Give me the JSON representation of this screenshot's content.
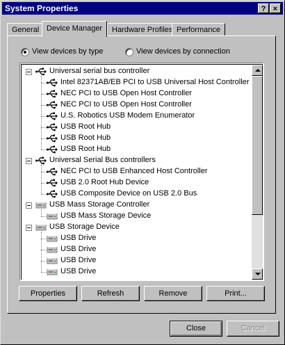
{
  "window": {
    "title": "System Properties",
    "help_label": "?",
    "close_label": "×"
  },
  "tabs": [
    {
      "label": "General",
      "active": false
    },
    {
      "label": "Device Manager",
      "active": true
    },
    {
      "label": "Hardware Profiles",
      "active": false
    },
    {
      "label": "Performance",
      "active": false
    }
  ],
  "view": {
    "by_type_label": "View devices by type",
    "by_connection_label": "View devices by connection",
    "selected": "by_type"
  },
  "devices": [
    {
      "level": 0,
      "icon": "usb-icon",
      "label": "Universal serial bus controller"
    },
    {
      "level": 1,
      "icon": "usb-icon",
      "label": "Intel 82371AB/EB PCI to USB Universal Host Controller"
    },
    {
      "level": 1,
      "icon": "usb-icon",
      "label": "NEC PCI to USB Open Host Controller"
    },
    {
      "level": 1,
      "icon": "usb-icon",
      "label": "NEC PCI to USB Open Host Controller"
    },
    {
      "level": 1,
      "icon": "usb-icon",
      "label": "U.S. Robotics USB Modem Enumerator"
    },
    {
      "level": 1,
      "icon": "usb-icon",
      "label": "USB Root Hub"
    },
    {
      "level": 1,
      "icon": "usb-icon",
      "label": "USB Root Hub"
    },
    {
      "level": 1,
      "icon": "usb-icon",
      "label": "USB Root Hub"
    },
    {
      "level": 0,
      "icon": "usb-icon",
      "label": "Universal Serial Bus controllers"
    },
    {
      "level": 1,
      "icon": "usb-icon",
      "label": "NEC PCI to USB Enhanced Host Controller"
    },
    {
      "level": 1,
      "icon": "usb-icon",
      "label": "USB 2.0 Root Hub Device"
    },
    {
      "level": 1,
      "icon": "usb-icon",
      "label": "USB Composite Device on USB 2.0 Bus"
    },
    {
      "level": 0,
      "icon": "drive-icon",
      "label": "USB Mass Storage Controller"
    },
    {
      "level": 1,
      "icon": "drive-icon",
      "label": "USB Mass Storage Device"
    },
    {
      "level": 0,
      "icon": "drive-icon",
      "label": "USB Storage Device"
    },
    {
      "level": 1,
      "icon": "drive-icon",
      "label": "USB Drive"
    },
    {
      "level": 1,
      "icon": "drive-icon",
      "label": "USB Drive"
    },
    {
      "level": 1,
      "icon": "drive-icon",
      "label": "USB Drive"
    },
    {
      "level": 1,
      "icon": "drive-icon",
      "label": "USB Drive"
    }
  ],
  "buttons": {
    "properties": "Properties",
    "refresh": "Refresh",
    "remove": "Remove",
    "print": "Print..."
  },
  "footer": {
    "close": "Close",
    "cancel": "Cancel"
  }
}
